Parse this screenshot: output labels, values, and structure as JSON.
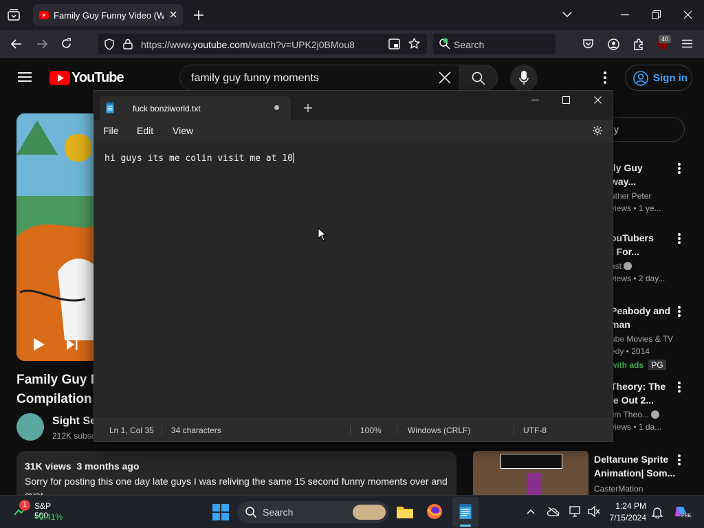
{
  "browser": {
    "tab_title": "Family Guy Funny Video (WARI",
    "url_prefix": "https://www.",
    "url_host": "youtube.com",
    "url_path": "/watch?v=UPK2j0BMou8",
    "search_label": "Search",
    "ext_badge": "40"
  },
  "youtube": {
    "logo_text": "YouTube",
    "search_query": "family guy funny moments",
    "signin_label": "Sign in",
    "video_title_line1": "Family Guy F",
    "video_title_line2": "Compilation",
    "channel_name": "Sight Se",
    "channel_subs": "212K subsc",
    "views": "31K views",
    "age": "3 months ago",
    "description": "Sorry for posting this one day late guys I was reliving the same 15 second funny moments over and over",
    "chip_partial": "y",
    "recommendations": [
      {
        "title1": "ily Guy",
        "title2": "way...",
        "sub1": "ather Peter",
        "sub2": "views  • 1 ye..."
      },
      {
        "title1": "ouTubers",
        "title2": "t For...",
        "sub1": "ast",
        "sub2": "views  • 2 day..."
      },
      {
        "title1": "Peabody and",
        "title2": "man",
        "sub1": "ube Movies & TV",
        "sub2": "edy • 2014",
        "badge1": "with ads",
        "badge2": "PG"
      },
      {
        "title1": "Theory: The",
        "title2": "le Out 2...",
        "sub1": "ilm Theo...",
        "sub2": "views  • 1 da..."
      }
    ],
    "last_rec": {
      "title1": "Deltarune Sprite",
      "title2": "Animation| Som...",
      "channel": "CasterMation"
    }
  },
  "notepad": {
    "filename": "fuck bonziworld.txt",
    "menu": [
      "File",
      "Edit",
      "View"
    ],
    "content": "hi guys its me colin visit me at 10",
    "status_pos": "Ln 1, Col 35",
    "status_chars": "34 characters",
    "status_zoom": "100%",
    "status_eol": "Windows (CRLF)",
    "status_enc": "UTF-8"
  },
  "taskbar": {
    "stock_name": "S&P 500",
    "stock_change": "+0.41%",
    "stock_badge": "1",
    "search_label": "Search",
    "time": "1:24 PM",
    "date": "7/15/2024",
    "pre_badge": "PRE"
  },
  "colors": {
    "yt_red": "#ff0000",
    "link_blue": "#3ea6ff",
    "stock_green": "#3fd16d"
  }
}
